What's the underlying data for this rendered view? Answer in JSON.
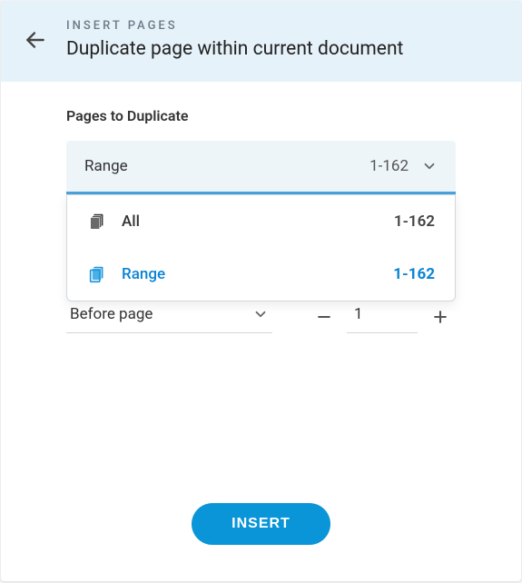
{
  "header": {
    "eyebrow": "INSERT PAGES",
    "title": "Duplicate page within current document"
  },
  "section": {
    "label": "Pages to Duplicate"
  },
  "rangeSelect": {
    "label": "Range",
    "value": "1-162"
  },
  "dropdown": {
    "options": [
      {
        "label": "All",
        "value": "1-162"
      },
      {
        "label": "Range",
        "value": "1-162"
      }
    ]
  },
  "placement": {
    "label": "Before page",
    "page": "1"
  },
  "footer": {
    "insert": "INSERT"
  }
}
